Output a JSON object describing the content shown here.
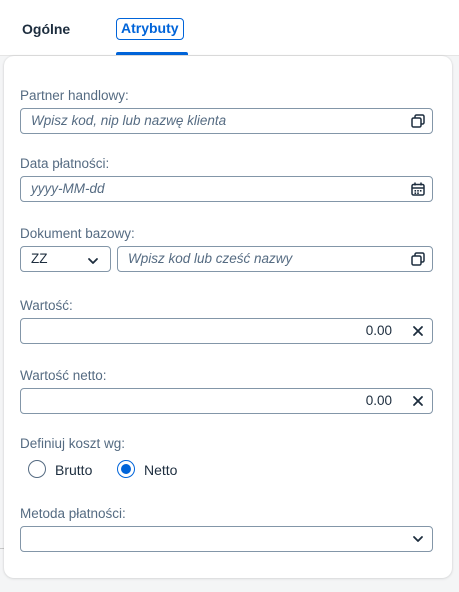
{
  "tabs": [
    {
      "label": "Ogólne",
      "active": false
    },
    {
      "label": "Atrybuty",
      "active": true
    }
  ],
  "form": {
    "partner": {
      "label": "Partner handlowy:",
      "placeholder": "Wpisz kod, nip lub nazwę klienta",
      "icon": "value-help-icon"
    },
    "payment_date": {
      "label": "Data płatności:",
      "placeholder": "yyyy-MM-dd",
      "icon": "calendar-icon"
    },
    "base_document": {
      "label": "Dokument bazowy:",
      "type_value": "ZZ",
      "placeholder": "Wpisz kod lub cześć nazwy",
      "icon": "value-help-icon"
    },
    "value": {
      "label": "Wartość:",
      "value": "0.00",
      "icon": "clear-icon"
    },
    "net_value": {
      "label": "Wartość netto:",
      "value": "0.00",
      "icon": "clear-icon"
    },
    "cost_basis": {
      "label": "Definiuj koszt wg:",
      "options": [
        {
          "label": "Brutto",
          "selected": false
        },
        {
          "label": "Netto",
          "selected": true
        }
      ]
    },
    "payment_method": {
      "label": "Metoda płatności:",
      "value": "",
      "icon": "chevron-down-icon"
    }
  },
  "colors": {
    "accent": "#0064d9",
    "label": "#556b82",
    "border": "#8396a8",
    "text": "#1d2d3e"
  }
}
